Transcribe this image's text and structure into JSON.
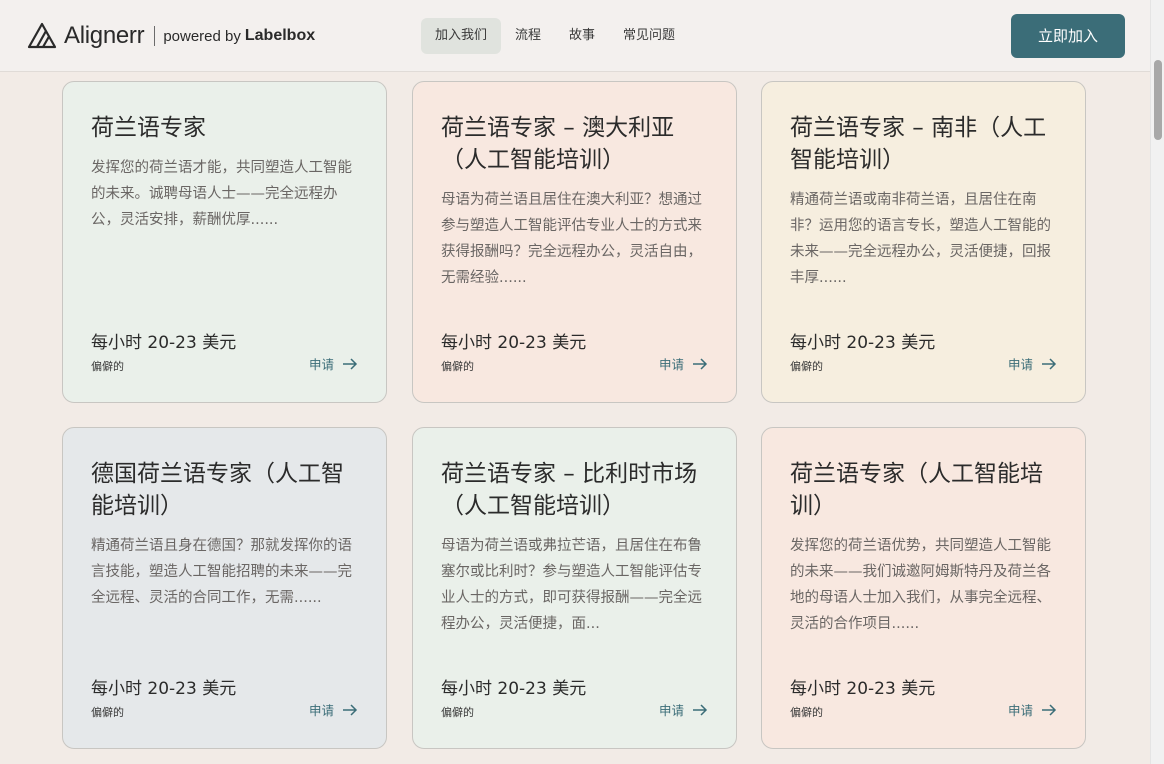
{
  "header": {
    "logo_text": "Alignerr",
    "powered_by": "powered by",
    "brand": "Labelbox",
    "nav": [
      {
        "label": "加入我们",
        "active": true
      },
      {
        "label": "流程",
        "active": false
      },
      {
        "label": "故事",
        "active": false
      },
      {
        "label": "常见问题",
        "active": false
      }
    ],
    "cta_label": "立即加入"
  },
  "colors": {
    "accent": "#3b6d78",
    "card_green": "#eaf0ea",
    "card_peach": "#f8e8e0",
    "card_cream": "#f6eedf",
    "card_gray": "#e5e8ea"
  },
  "cards": [
    {
      "title": "荷兰语专家",
      "description": "发挥您的荷兰语才能，共同塑造人工智能的未来。诚聘母语人士——完全远程办公，灵活安排，薪酬优厚......",
      "pay": "每小时 20-23 美元",
      "tag": "偏僻的",
      "apply_label": "申请",
      "color": "green"
    },
    {
      "title": "荷兰语专家 – 澳大利亚（人工智能培训）",
      "description": "母语为荷兰语且居住在澳大利亚？想通过参与塑造人工智能评估专业人士的方式来获得报酬吗？完全远程办公，灵活自由，无需经验......",
      "pay": "每小时 20-23 美元",
      "tag": "偏僻的",
      "apply_label": "申请",
      "color": "peach"
    },
    {
      "title": "荷兰语专家 – 南非（人工智能培训）",
      "description": "精通荷兰语或南非荷兰语，且居住在南非？运用您的语言专长，塑造人工智能的未来——完全远程办公，灵活便捷，回报丰厚......",
      "pay": "每小时 20-23 美元",
      "tag": "偏僻的",
      "apply_label": "申请",
      "color": "cream"
    },
    {
      "title": "德国荷兰语专家（人工智能培训）",
      "description": "精通荷兰语且身在德国？那就发挥你的语言技能，塑造人工智能招聘的未来——完全远程、灵活的合同工作，无需......",
      "pay": "每小时 20-23 美元",
      "tag": "偏僻的",
      "apply_label": "申请",
      "color": "gray"
    },
    {
      "title": "荷兰语专家 – 比利时市场（人工智能培训）",
      "description": "母语为荷兰语或弗拉芒语，且居住在布鲁塞尔或比利时？参与塑造人工智能评估专业人士的方式，即可获得报酬——完全远程办公，灵活便捷，面...",
      "pay": "每小时 20-23 美元",
      "tag": "偏僻的",
      "apply_label": "申请",
      "color": "green"
    },
    {
      "title": "荷兰语专家（人工智能培训）",
      "description": "发挥您的荷兰语优势，共同塑造人工智能的未来——我们诚邀阿姆斯特丹及荷兰各地的母语人士加入我们，从事完全远程、灵活的合作项目......",
      "pay": "每小时 20-23 美元",
      "tag": "偏僻的",
      "apply_label": "申请",
      "color": "peach"
    }
  ]
}
